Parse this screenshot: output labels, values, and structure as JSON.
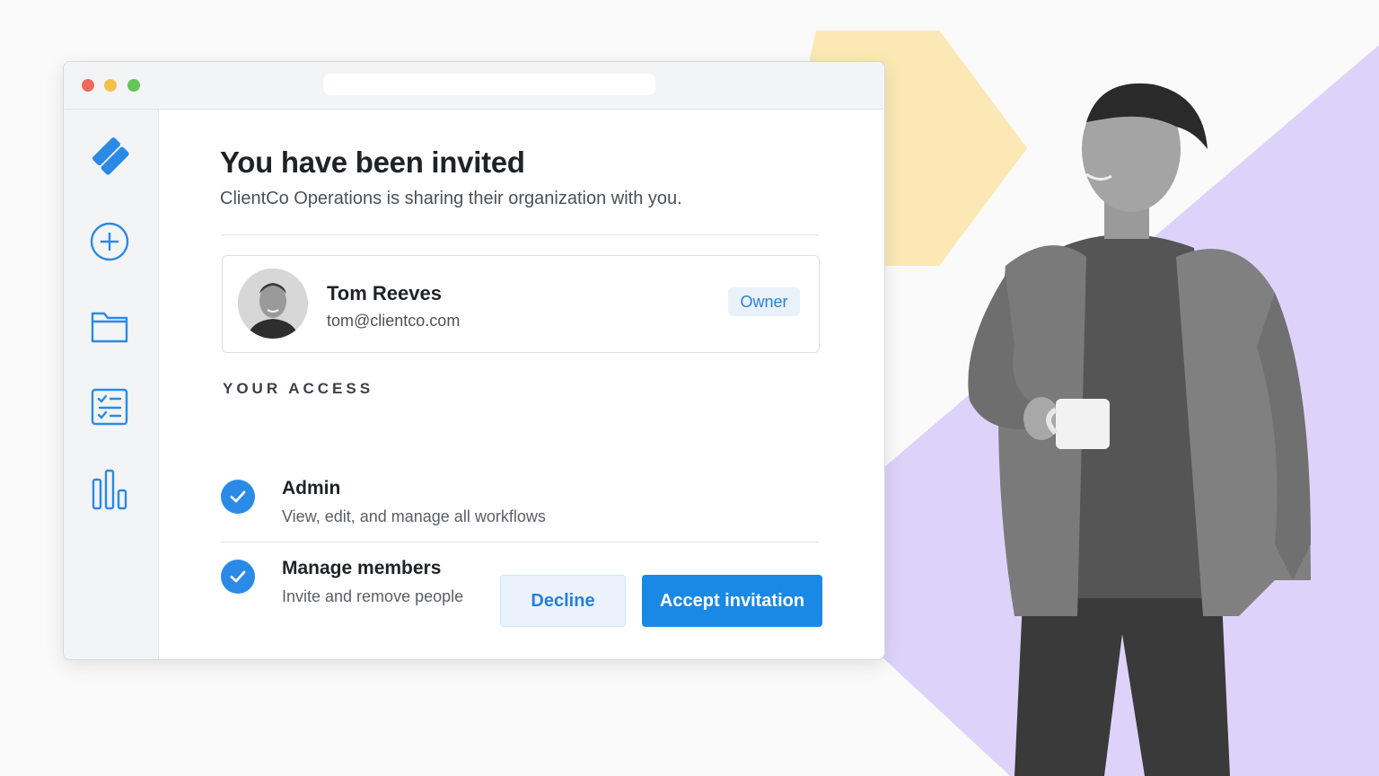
{
  "invite": {
    "title": "You have been invited",
    "subtitle": "ClientCo Operations is sharing their organization with you."
  },
  "owner": {
    "name": "Tom Reeves",
    "email": "tom@clientco.com",
    "role_badge": "Owner"
  },
  "access": {
    "heading": "YOUR ACCESS",
    "permissions": [
      {
        "title": "Admin",
        "description": "View, edit, and manage all workflows"
      },
      {
        "title": "Manage members",
        "description": "Invite and remove people"
      }
    ]
  },
  "actions": {
    "decline_label": "Decline",
    "accept_label": "Accept invitation"
  },
  "sidebar": {
    "icons": [
      "logo-icon",
      "add-circle-icon",
      "folder-icon",
      "checklist-icon",
      "bar-chart-icon"
    ]
  },
  "colors": {
    "accent": "#1a88e5",
    "hexagon": "#fbe8b4",
    "purple_shape": "#ddd3fa"
  }
}
